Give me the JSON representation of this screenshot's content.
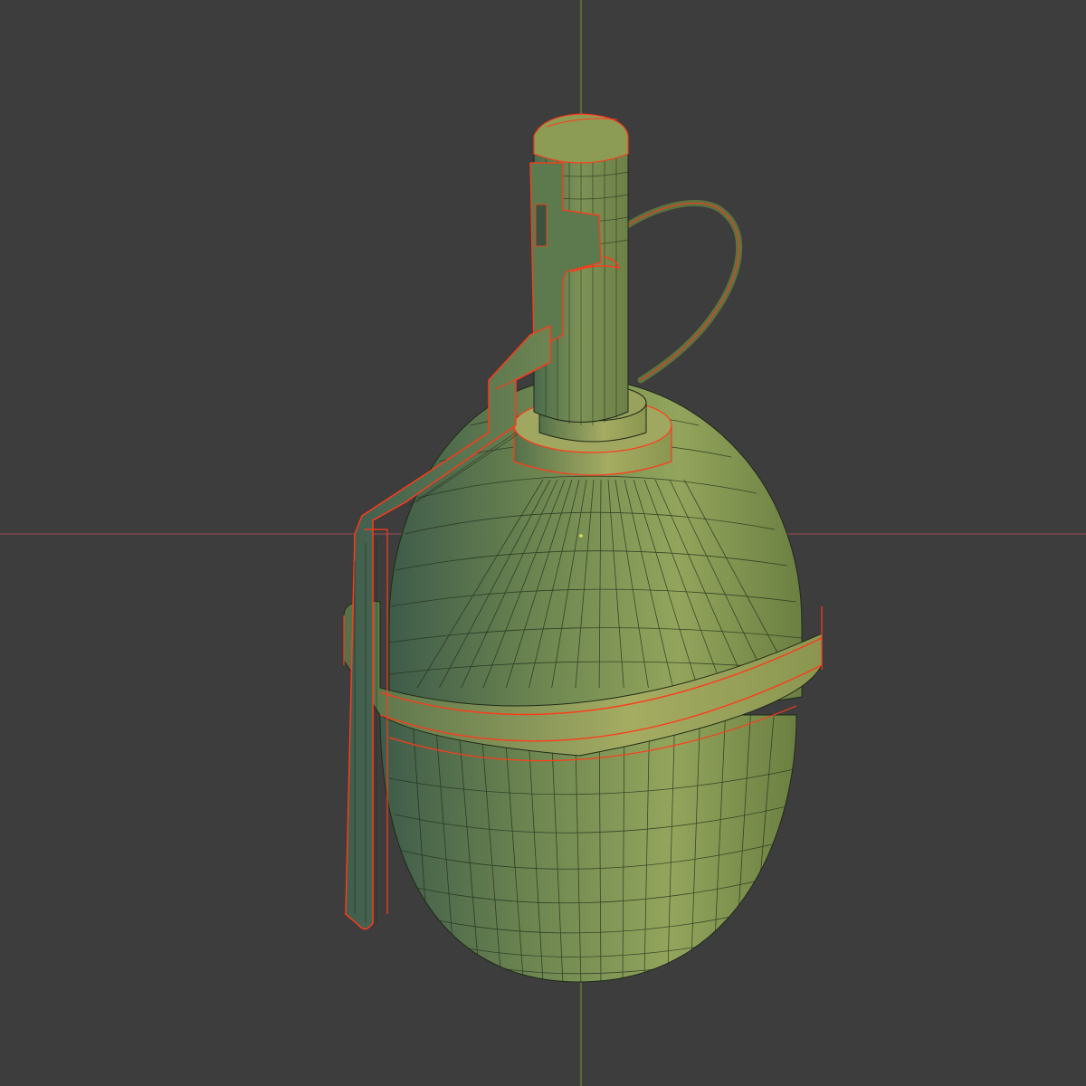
{
  "viewport": {
    "background": "#3d3d3d",
    "axes": {
      "x_axis_color": "#8a4a50",
      "y_axis_color": "#6a8a38"
    },
    "object": {
      "name": "grenade",
      "base_color": "#6f8748",
      "lit_color": "#9aa85c",
      "shadow_color": "#3f5c48",
      "wire_color": "#1f2a18",
      "selection_outline_color": "#ff3a1a"
    },
    "origin_marker_color": "#e0e060"
  }
}
